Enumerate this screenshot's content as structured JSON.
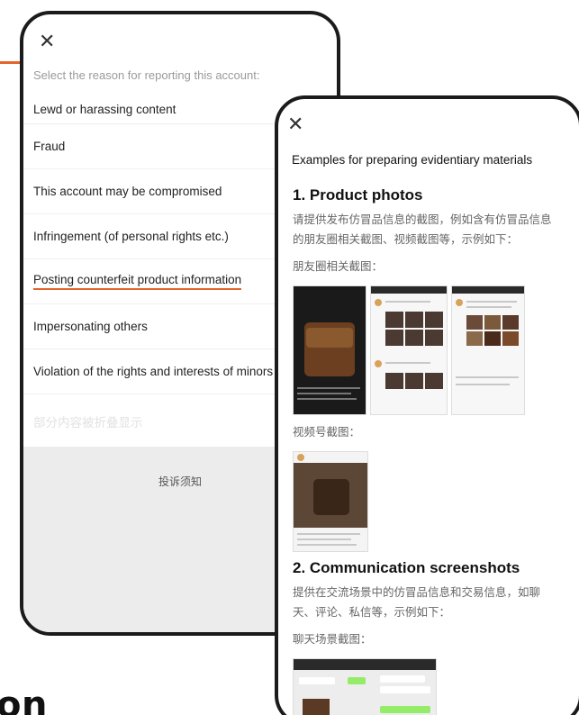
{
  "background": {
    "heading": "on",
    "accent_color": "#e5642d"
  },
  "report_panel": {
    "close_icon": "close-icon",
    "prompt": "Select the reason for reporting this account:",
    "reasons": [
      "Lewd or harassing content",
      "Fraud",
      "This account may be compromised",
      "Infringement (of personal rights etc.)",
      "Posting counterfeit product information",
      "Impersonating others",
      "Violation of the rights and interests of minors",
      "部分内容被折叠显示"
    ],
    "selected_index": 4,
    "notice_link": "投诉须知"
  },
  "evidence_panel": {
    "close_icon": "close-icon",
    "title": "Examples for preparing evidentiary materials",
    "section1": {
      "heading": "1. Product photos",
      "description": "请提供发布仿冒品信息的截图，例如含有仿冒品信息的朋友圈相关截图、视频截图等，示例如下：",
      "moments_label": "朋友圈相关截图：",
      "video_label": "视频号截图："
    },
    "section2": {
      "heading": "2. Communication screenshots",
      "description": "提供在交流场景中的仿冒品信息和交易信息，如聊天、评论、私信等，示例如下：",
      "chat_label": "聊天场景截图："
    }
  }
}
